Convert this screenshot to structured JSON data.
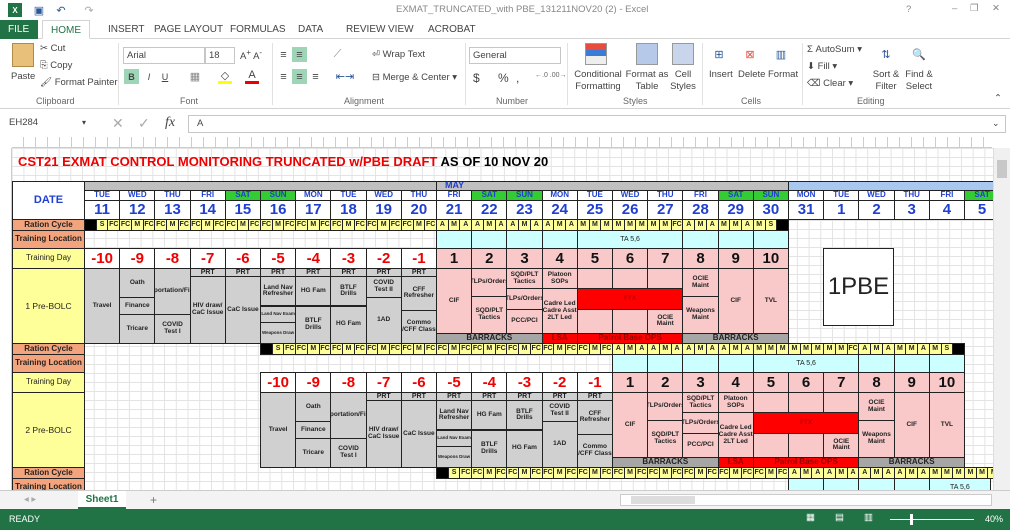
{
  "window": {
    "title": "EXMAT_TRUNCATED_with PBE_131211NOV20 (2) - Excel",
    "help": "?",
    "minimize": "–",
    "restore": "❐",
    "close": "✕"
  },
  "tabs": [
    "FILE",
    "HOME",
    "INSERT",
    "PAGE LAYOUT",
    "FORMULAS",
    "DATA",
    "REVIEW",
    "VIEW",
    "ACROBAT"
  ],
  "ribbon": {
    "clipboard": {
      "paste": "Paste",
      "cut": "Cut",
      "copy": "Copy",
      "format_painter": "Format Painter",
      "group": "Clipboard"
    },
    "font": {
      "name": "Arial",
      "size": "18",
      "bold": "B",
      "italic": "I",
      "underline": "U",
      "group": "Font"
    },
    "alignment": {
      "wrap": "Wrap Text",
      "merge": "Merge & Center",
      "group": "Alignment"
    },
    "number": {
      "format": "General",
      "currency": "$",
      "percent": "%",
      "comma": ",",
      "group": "Number"
    },
    "styles": {
      "conditional": "Conditional Formatting",
      "table": "Format as Table",
      "cell": "Cell Styles",
      "group": "Styles"
    },
    "cells": {
      "insert": "Insert",
      "delete": "Delete",
      "format": "Format",
      "group": "Cells"
    },
    "editing": {
      "autosum": "AutoSum",
      "fill": "Fill",
      "clear": "Clear",
      "sort": "Sort & Filter",
      "find": "Find & Select",
      "group": "Editing"
    }
  },
  "formula_bar": {
    "name_box": "EH284",
    "fx": "fx",
    "value": "A"
  },
  "sheet": {
    "title_red": "CST21 EXMAT CONTROL MONITORING TRUNCATED w/PBE DRAFT",
    "title_black": "AS OF 10 NOV 20",
    "month": "MAY",
    "date_label": "DATE",
    "weekdays": [
      "TUE",
      "WED",
      "THU",
      "FRI",
      "SAT",
      "SUN",
      "MON",
      "TUE",
      "WED",
      "THU",
      "FRI",
      "SAT",
      "SUN",
      "MON",
      "TUE",
      "WED",
      "THU",
      "FRI",
      "SAT",
      "SUN",
      "MON",
      "TUE",
      "WED",
      "THU",
      "FRI",
      "SAT"
    ],
    "dates": [
      "11",
      "12",
      "13",
      "14",
      "15",
      "16",
      "17",
      "18",
      "19",
      "20",
      "21",
      "22",
      "23",
      "24",
      "25",
      "26",
      "27",
      "28",
      "29",
      "30",
      "31",
      "1",
      "2",
      "3",
      "4",
      "5"
    ],
    "pbe_box": "1PBE",
    "colors": {
      "ration_label": "#f4a47c",
      "yellow": "#ffff99",
      "weekend": "#33cc33",
      "gray": "#d0d0d0",
      "pink": "#f9c9c9",
      "cyan": "#ccffff",
      "red": "#ff0000",
      "barracks": "#a6a6a6"
    }
  },
  "schedule": {
    "training_days": [
      "-10",
      "-9",
      "-8",
      "-7",
      "-6",
      "-5",
      "-4",
      "-3",
      "-2",
      "-1",
      "1",
      "2",
      "3",
      "4",
      "5",
      "6",
      "7",
      "8",
      "9",
      "10"
    ],
    "ration": [
      [
        "X",
        "S",
        "FC"
      ],
      [
        "FC",
        "M",
        "FC"
      ],
      [
        "FC",
        "M",
        "FC"
      ],
      [
        "FC",
        "M",
        "FC"
      ],
      [
        "FC",
        "M",
        "FC"
      ],
      [
        "FC",
        "M",
        "FC"
      ],
      [
        "FC",
        "M",
        "FC"
      ],
      [
        "FC",
        "M",
        "FC"
      ],
      [
        "FC",
        "M",
        "FC"
      ],
      [
        "FC",
        "M",
        "FC"
      ],
      [
        "A",
        "M",
        "A"
      ],
      [
        "A",
        "M",
        "A"
      ],
      [
        "A",
        "M",
        "A"
      ],
      [
        "A",
        "M",
        "A"
      ],
      [
        "M",
        "M",
        "M"
      ],
      [
        "M",
        "M",
        "M"
      ],
      [
        "M",
        "M",
        "FC"
      ],
      [
        "A",
        "M",
        "A"
      ],
      [
        "M",
        "M",
        "A"
      ],
      [
        "M",
        "S",
        "X"
      ]
    ],
    "training_location": {
      "text": "TA 5,6",
      "merged_days": [
        "5",
        "6",
        "7"
      ]
    },
    "events": [
      [
        {
          "t": "Travel",
          "s": 18
        }
      ],
      [
        {
          "t": "Oath",
          "s": 7
        },
        {
          "t": "Finance",
          "s": 4
        },
        {
          "t": "Tricare",
          "s": 7
        }
      ],
      [
        {
          "t": "Transportation/Finance",
          "s": 11
        },
        {
          "t": "COVID Test I",
          "s": 7
        }
      ],
      [
        {
          "t": "PRT",
          "s": 2
        },
        {
          "t": "HIV draw/ CaC Issue",
          "s": 16
        }
      ],
      [
        {
          "t": "PRT",
          "s": 2
        },
        {
          "t": "CaC Issue",
          "s": 16
        }
      ],
      [
        {
          "t": "PRT",
          "s": 2
        },
        {
          "t": "Land Nav Refresher",
          "s": 7
        },
        {
          "t": "Land Nav Exam",
          "s": 4,
          "small": true
        },
        {
          "t": "Weapons Draw",
          "s": 5,
          "small": true
        }
      ],
      [
        {
          "t": "PRT",
          "s": 2
        },
        {
          "t": "HG Fam",
          "s": 7
        },
        {
          "t": "BTLF Drills",
          "s": 9
        }
      ],
      [
        {
          "t": "PRT",
          "s": 2
        },
        {
          "t": "BTLF Drills",
          "s": 7
        },
        {
          "t": "HG Fam",
          "s": 9
        }
      ],
      [
        {
          "t": "PRT",
          "s": 2
        },
        {
          "t": "COVID Test II",
          "s": 5
        },
        {
          "t": "1AD",
          "s": 11
        }
      ],
      [
        {
          "t": "PRT",
          "s": 2
        },
        {
          "t": "CFF Refresher",
          "s": 8
        },
        {
          "t": "Commo /CFF Class",
          "s": 8
        }
      ],
      [
        {
          "t": "CIF",
          "s": 16
        }
      ],
      [
        {
          "t": "TLPs/Orders",
          "s": 7
        },
        {
          "t": "SQD/PLT Tactics",
          "s": 9
        }
      ],
      [
        {
          "t": "SQD/PLT Tactics",
          "s": 5
        },
        {
          "t": "TLPs/Orders",
          "s": 5
        },
        {
          "t": "PCC/PCI",
          "s": 6
        }
      ],
      [
        {
          "t": "Platoon SOPs",
          "s": 5
        },
        {
          "t": "Cadre Led Cadre Asst 2LT Led",
          "s": 11
        }
      ],
      [
        {
          "t": "",
          "s": 5
        },
        {
          "t": "FTX",
          "s": 5,
          "red": true,
          "span": 3
        },
        {
          "t": "",
          "s": 6
        }
      ],
      [
        {
          "t": "",
          "s": 5
        },
        {
          "cover": true,
          "s": 5
        },
        {
          "t": "",
          "s": 6
        }
      ],
      [
        {
          "t": "",
          "s": 5
        },
        {
          "cover": true,
          "s": 5
        },
        {
          "t": "OCIE Maint",
          "s": 6
        }
      ],
      [
        {
          "t": "OCIE Maint",
          "s": 7
        },
        {
          "t": "Weapons Maint",
          "s": 9
        }
      ],
      [
        {
          "t": "CIF",
          "s": 16
        }
      ],
      [
        {
          "t": "TVL",
          "s": 16
        }
      ]
    ],
    "bottom_row": [
      {
        "t": "BARRACKS",
        "from": "1",
        "to": "3",
        "kind": "gray"
      },
      {
        "t": "LSA",
        "from": "4",
        "to": "4",
        "kind": "red"
      },
      {
        "t": "Patrol Base OPS",
        "from": "5",
        "to": "7",
        "kind": "red"
      },
      {
        "t": "BARRACKS",
        "from": "8",
        "to": "10",
        "kind": "gray"
      }
    ]
  },
  "sections": [
    {
      "start_date": "11",
      "labels": {
        "ration": "Ration Cycle",
        "location": "Training Location",
        "day": "Training Day",
        "block": "1 Pre-BOLC"
      }
    },
    {
      "start_date": "16",
      "labels": {
        "ration": "Ration Cycle",
        "location": "Training Location",
        "day": "Training Day",
        "block": "2 Pre-BOLC"
      }
    },
    {
      "start_date": "21",
      "labels": {
        "ration": "Ration Cycle",
        "location": "Training Location"
      }
    }
  ],
  "sheet_tabs": {
    "active": "Sheet1",
    "add": "+"
  },
  "status": {
    "ready": "READY",
    "zoom": "40%"
  }
}
